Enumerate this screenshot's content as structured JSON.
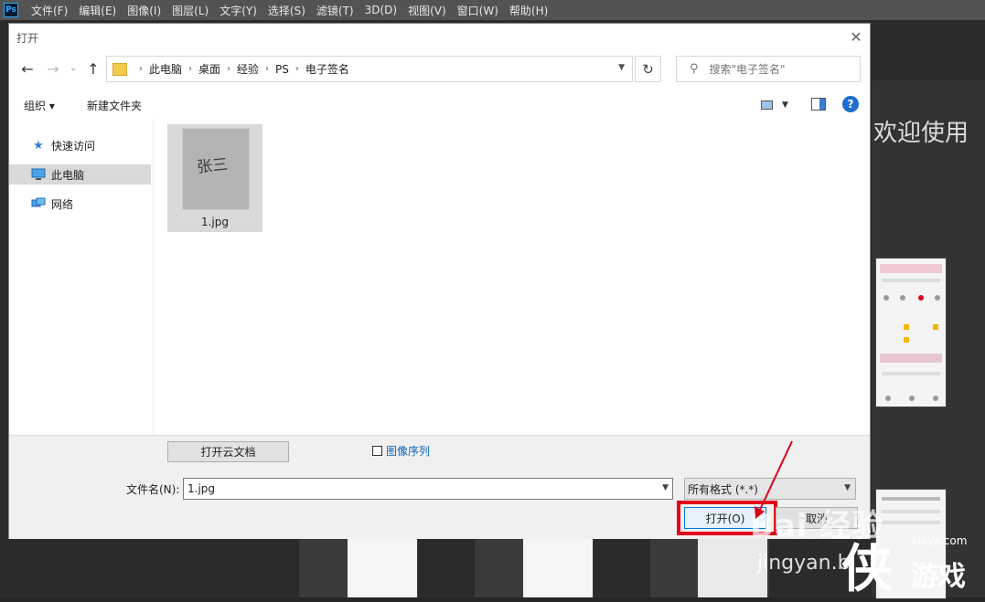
{
  "app": {
    "logo": "Ps",
    "menu": [
      "文件(F)",
      "编辑(E)",
      "图像(I)",
      "图层(L)",
      "文字(Y)",
      "选择(S)",
      "滤镜(T)",
      "3D(D)",
      "视图(V)",
      "窗口(W)",
      "帮助(H)"
    ],
    "welcome_text": "欢迎使用"
  },
  "dialog": {
    "title": "打开",
    "breadcrumb": [
      "此电脑",
      "桌面",
      "经验",
      "PS",
      "电子签名"
    ],
    "search_placeholder": "搜索\"电子签名\"",
    "toolbar": {
      "organize": "组织 ▾",
      "new_folder": "新建文件夹"
    },
    "nav": [
      {
        "label": "快速访问",
        "icon": "star-icon",
        "selected": false
      },
      {
        "label": "此电脑",
        "icon": "computer-icon",
        "selected": true
      },
      {
        "label": "网络",
        "icon": "network-icon",
        "selected": false
      }
    ],
    "files": [
      {
        "name": "1.jpg",
        "thumb_text": "张三"
      }
    ],
    "cloud_button": "打开云文档",
    "image_sequence_label": "图像序列",
    "filename_label": "文件名(N):",
    "filename_value": "1.jpg",
    "filetype_value": "所有格式 (*.*)",
    "open_button": "打开(O)",
    "cancel_button": "取消"
  },
  "watermarks": {
    "baidu": "Bai 经验",
    "jingyan_url": "jingyan.b",
    "game_char": "侠",
    "game_text": "游戏",
    "site": "xiayx.com"
  },
  "colors": {
    "highlight": "#e0001b",
    "accent": "#0078d7"
  }
}
